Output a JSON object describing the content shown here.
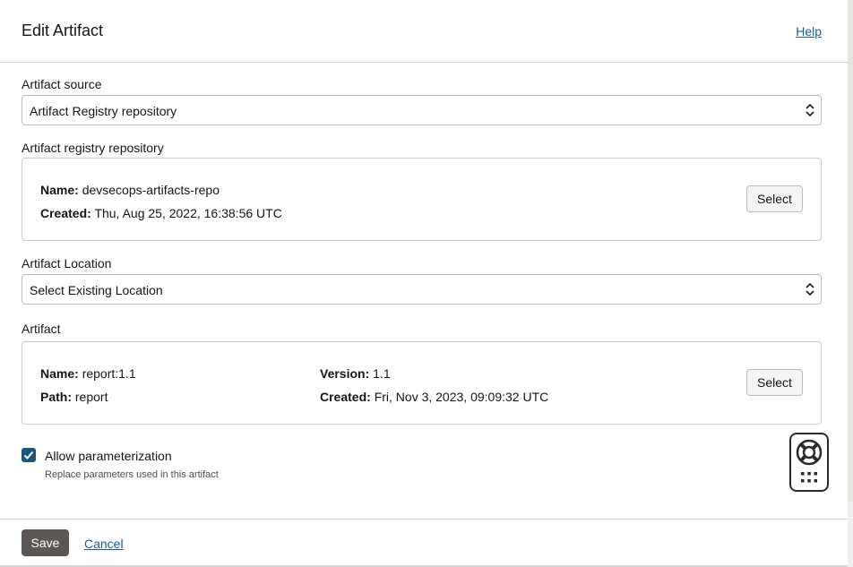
{
  "header": {
    "title": "Edit Artifact",
    "help_label": "Help"
  },
  "artifact_source": {
    "label": "Artifact source",
    "selected": "Artifact Registry repository"
  },
  "registry_repository": {
    "label": "Artifact registry repository",
    "name_label": "Name:",
    "name_value": "devsecops-artifacts-repo",
    "created_label": "Created:",
    "created_value": "Thu, Aug 25, 2022, 16:38:56 UTC",
    "select_label": "Select"
  },
  "artifact_location": {
    "label": "Artifact Location",
    "selected": "Select Existing Location"
  },
  "artifact": {
    "label": "Artifact",
    "name_label": "Name:",
    "name_value": "report:1.1",
    "path_label": "Path:",
    "path_value": "report",
    "version_label": "Version:",
    "version_value": "1.1",
    "created_label": "Created:",
    "created_value": "Fri, Nov 3, 2023, 09:09:32 UTC",
    "select_label": "Select"
  },
  "parameterization": {
    "checked": true,
    "label": "Allow parameterization",
    "help_text": "Replace parameters used in this artifact"
  },
  "footer": {
    "save_label": "Save",
    "cancel_label": "Cancel"
  },
  "icons": {
    "chevrons": "up-down-chevrons-icon",
    "checkmark": "checkmark-icon",
    "help_widget": "lifebuoy-icon",
    "grid": "grid-dots-icon"
  },
  "colors": {
    "link": "#1c5d86",
    "checkbox": "#19587c",
    "primary_button": "#5c5755"
  }
}
